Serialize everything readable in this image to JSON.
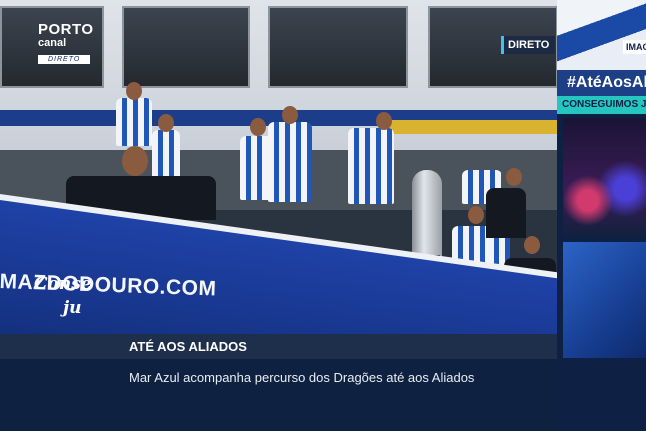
{
  "broadcast": {
    "logo": {
      "line1": "PORTO",
      "line2": "canal",
      "line3": "DIRETO"
    },
    "live_badge": "DIRETO",
    "banner_text": "MAZDODOURO.COM"
  },
  "lower_third": {
    "title": "ATÉ AOS ALIADOS",
    "subtitle": "Mar Azul acompanha percurso dos Dragões até aos Aliados"
  },
  "side_rail": {
    "tag": "IMAG",
    "hashtag": "#AtéAosAlia",
    "strip": "CONSEGUIMOS JUN",
    "card_text_line1": "Conse",
    "card_text_line2": "ju"
  },
  "colors": {
    "navy": "#0f2140",
    "live_accent": "#3fc3ee",
    "teal": "#26c6c0",
    "porto_blue": "#1f42a8"
  }
}
